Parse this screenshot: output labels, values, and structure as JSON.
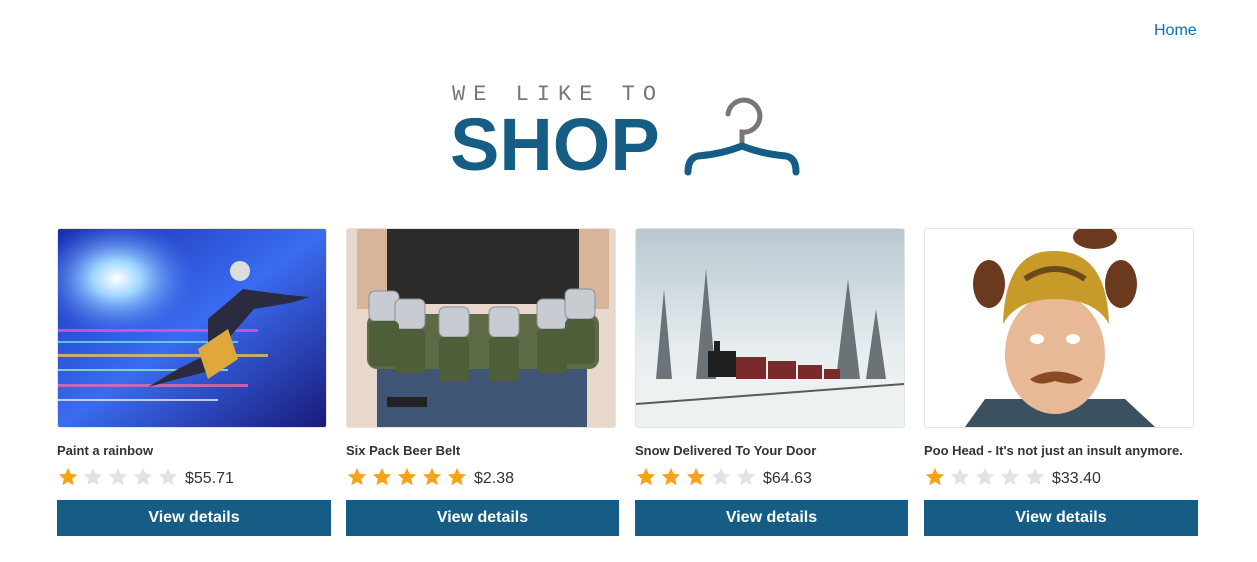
{
  "nav": {
    "home_label": "Home"
  },
  "logo": {
    "tagline": "WE LIKE TO",
    "word": "SHOP"
  },
  "colors": {
    "brand": "#155d85",
    "link": "#0071bc",
    "star_on": "#f7a21b",
    "star_off": "#dfe3e6"
  },
  "products": [
    {
      "title": "Paint a rainbow",
      "rating": 1,
      "price": "$55.71",
      "button_label": "View details",
      "image_icon": "rainbow-runner-image"
    },
    {
      "title": "Six Pack Beer Belt",
      "rating": 5,
      "price": "$2.38",
      "button_label": "View details",
      "image_icon": "beer-belt-image"
    },
    {
      "title": "Snow Delivered To Your Door",
      "rating": 3,
      "price": "$64.63",
      "button_label": "View details",
      "image_icon": "snow-train-image"
    },
    {
      "title": "Poo Head - It's not just an insult anymore.",
      "rating": 1,
      "price": "$33.40",
      "button_label": "View details",
      "image_icon": "poo-head-image"
    }
  ]
}
